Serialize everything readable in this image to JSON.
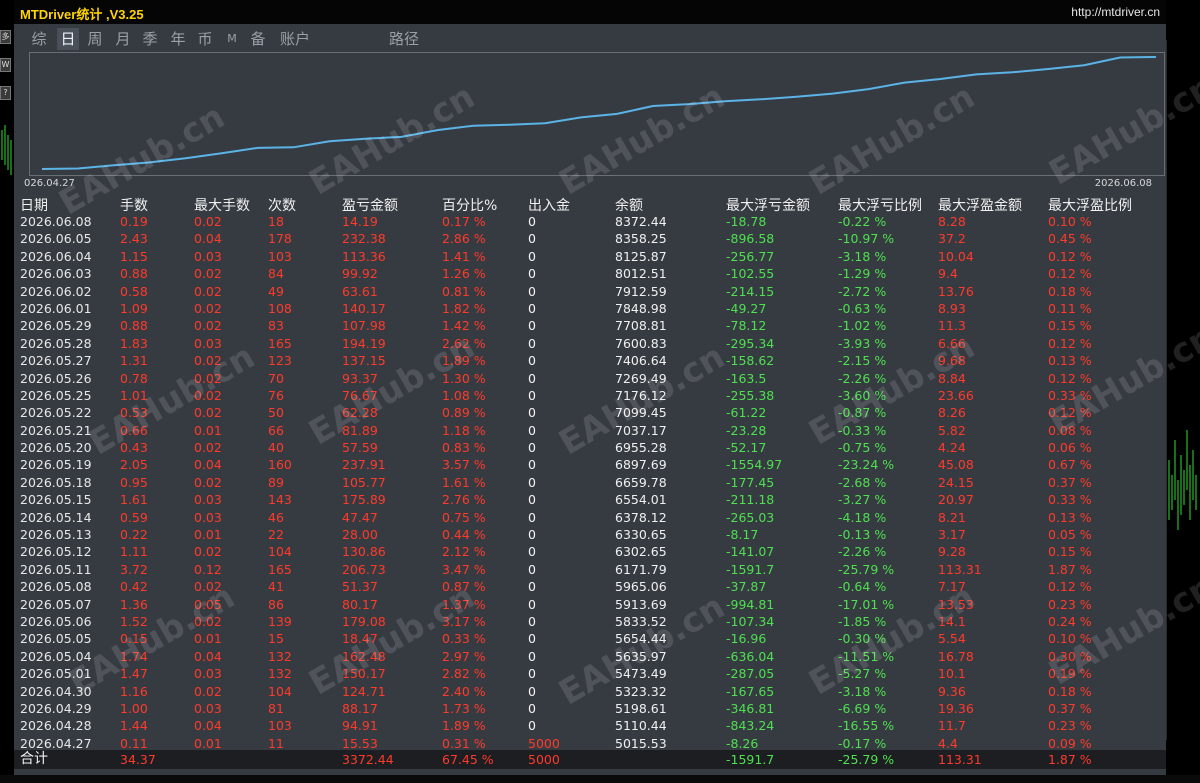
{
  "app": {
    "title": "MTDriver统计 ,V3.25",
    "url": "http://mtdriver.cn"
  },
  "tabs": [
    {
      "label": "综",
      "active": false
    },
    {
      "label": "日",
      "active": true
    },
    {
      "label": "周",
      "active": false
    },
    {
      "label": "月",
      "active": false
    },
    {
      "label": "季",
      "active": false
    },
    {
      "label": "年",
      "active": false
    },
    {
      "label": "币",
      "active": false
    },
    {
      "label": "M",
      "active": false
    },
    {
      "label": "备",
      "active": false
    },
    {
      "label": "账户",
      "active": false
    },
    {
      "label": "路径",
      "active": false
    }
  ],
  "side_buttons": [
    "多",
    "W",
    "?"
  ],
  "watermark": "EAHub.cn",
  "chart": {
    "start_label": "026.04.27",
    "end_label": "2026.06.08",
    "line_color": "#5bb3e6"
  },
  "table": {
    "headers": [
      "日期",
      "手数",
      "最大手数",
      "次数",
      "盈亏金额",
      "百分比%",
      "出入金",
      "余额",
      "最大浮亏金额",
      "最大浮亏比例",
      "最大浮盈金额",
      "最大浮盈比例"
    ],
    "rows": [
      [
        "2026.06.08",
        "0.19",
        "0.02",
        "18",
        "14.19",
        "0.17 %",
        "0",
        "8372.44",
        "-18.78",
        "-0.22 %",
        "8.28",
        "0.10 %"
      ],
      [
        "2026.06.05",
        "2.43",
        "0.04",
        "178",
        "232.38",
        "2.86 %",
        "0",
        "8358.25",
        "-896.58",
        "-10.97 %",
        "37.2",
        "0.45 %"
      ],
      [
        "2026.06.04",
        "1.15",
        "0.03",
        "103",
        "113.36",
        "1.41 %",
        "0",
        "8125.87",
        "-256.77",
        "-3.18 %",
        "10.04",
        "0.12 %"
      ],
      [
        "2026.06.03",
        "0.88",
        "0.02",
        "84",
        "99.92",
        "1.26 %",
        "0",
        "8012.51",
        "-102.55",
        "-1.29 %",
        "9.4",
        "0.12 %"
      ],
      [
        "2026.06.02",
        "0.58",
        "0.02",
        "49",
        "63.61",
        "0.81 %",
        "0",
        "7912.59",
        "-214.15",
        "-2.72 %",
        "13.76",
        "0.18 %"
      ],
      [
        "2026.06.01",
        "1.09",
        "0.02",
        "108",
        "140.17",
        "1.82 %",
        "0",
        "7848.98",
        "-49.27",
        "-0.63 %",
        "8.93",
        "0.11 %"
      ],
      [
        "2026.05.29",
        "0.88",
        "0.02",
        "83",
        "107.98",
        "1.42 %",
        "0",
        "7708.81",
        "-78.12",
        "-1.02 %",
        "11.3",
        "0.15 %"
      ],
      [
        "2026.05.28",
        "1.83",
        "0.03",
        "165",
        "194.19",
        "2.62 %",
        "0",
        "7600.83",
        "-295.34",
        "-3.93 %",
        "6.66",
        "0.12 %"
      ],
      [
        "2026.05.27",
        "1.31",
        "0.02",
        "123",
        "137.15",
        "1.89 %",
        "0",
        "7406.64",
        "-158.62",
        "-2.15 %",
        "9.68",
        "0.13 %"
      ],
      [
        "2026.05.26",
        "0.78",
        "0.02",
        "70",
        "93.37",
        "1.30 %",
        "0",
        "7269.49",
        "-163.5",
        "-2.26 %",
        "8.84",
        "0.12 %"
      ],
      [
        "2026.05.25",
        "1.01",
        "0.02",
        "76",
        "76.67",
        "1.08 %",
        "0",
        "7176.12",
        "-255.38",
        "-3.60 %",
        "23.66",
        "0.33 %"
      ],
      [
        "2026.05.22",
        "0.53",
        "0.02",
        "50",
        "62.28",
        "0.89 %",
        "0",
        "7099.45",
        "-61.22",
        "-0.87 %",
        "8.26",
        "0.12 %"
      ],
      [
        "2026.05.21",
        "0.66",
        "0.01",
        "66",
        "81.89",
        "1.18 %",
        "0",
        "7037.17",
        "-23.28",
        "-0.33 %",
        "5.82",
        "0.08 %"
      ],
      [
        "2026.05.20",
        "0.43",
        "0.02",
        "40",
        "57.59",
        "0.83 %",
        "0",
        "6955.28",
        "-52.17",
        "-0.75 %",
        "4.24",
        "0.06 %"
      ],
      [
        "2026.05.19",
        "2.05",
        "0.04",
        "160",
        "237.91",
        "3.57 %",
        "0",
        "6897.69",
        "-1554.97",
        "-23.24 %",
        "45.08",
        "0.67 %"
      ],
      [
        "2026.05.18",
        "0.95",
        "0.02",
        "89",
        "105.77",
        "1.61 %",
        "0",
        "6659.78",
        "-177.45",
        "-2.68 %",
        "24.15",
        "0.37 %"
      ],
      [
        "2026.05.15",
        "1.61",
        "0.03",
        "143",
        "175.89",
        "2.76 %",
        "0",
        "6554.01",
        "-211.18",
        "-3.27 %",
        "20.97",
        "0.33 %"
      ],
      [
        "2026.05.14",
        "0.59",
        "0.03",
        "46",
        "47.47",
        "0.75 %",
        "0",
        "6378.12",
        "-265.03",
        "-4.18 %",
        "8.21",
        "0.13 %"
      ],
      [
        "2026.05.13",
        "0.22",
        "0.01",
        "22",
        "28.00",
        "0.44 %",
        "0",
        "6330.65",
        "-8.17",
        "-0.13 %",
        "3.17",
        "0.05 %"
      ],
      [
        "2026.05.12",
        "1.11",
        "0.02",
        "104",
        "130.86",
        "2.12 %",
        "0",
        "6302.65",
        "-141.07",
        "-2.26 %",
        "9.28",
        "0.15 %"
      ],
      [
        "2026.05.11",
        "3.72",
        "0.12",
        "165",
        "206.73",
        "3.47 %",
        "0",
        "6171.79",
        "-1591.7",
        "-25.79 %",
        "113.31",
        "1.87 %"
      ],
      [
        "2026.05.08",
        "0.42",
        "0.02",
        "41",
        "51.37",
        "0.87 %",
        "0",
        "5965.06",
        "-37.87",
        "-0.64 %",
        "7.17",
        "0.12 %"
      ],
      [
        "2026.05.07",
        "1.36",
        "0.05",
        "86",
        "80.17",
        "1.37 %",
        "0",
        "5913.69",
        "-994.81",
        "-17.01 %",
        "13.53",
        "0.23 %"
      ],
      [
        "2026.05.06",
        "1.52",
        "0.02",
        "139",
        "179.08",
        "3.17 %",
        "0",
        "5833.52",
        "-107.34",
        "-1.85 %",
        "14.1",
        "0.24 %"
      ],
      [
        "2026.05.05",
        "0.15",
        "0.01",
        "15",
        "18.47",
        "0.33 %",
        "0",
        "5654.44",
        "-16.96",
        "-0.30 %",
        "5.54",
        "0.10 %"
      ],
      [
        "2026.05.04",
        "1.74",
        "0.04",
        "132",
        "162.48",
        "2.97 %",
        "0",
        "5635.97",
        "-636.04",
        "-11.51 %",
        "16.78",
        "0.30 %"
      ],
      [
        "2026.05.01",
        "1.47",
        "0.03",
        "132",
        "150.17",
        "2.82 %",
        "0",
        "5473.49",
        "-287.05",
        "-5.27 %",
        "10.1",
        "0.19 %"
      ],
      [
        "2026.04.30",
        "1.16",
        "0.02",
        "104",
        "124.71",
        "2.40 %",
        "0",
        "5323.32",
        "-167.65",
        "-3.18 %",
        "9.36",
        "0.18 %"
      ],
      [
        "2026.04.29",
        "1.00",
        "0.03",
        "81",
        "88.17",
        "1.73 %",
        "0",
        "5198.61",
        "-346.81",
        "-6.69 %",
        "19.36",
        "0.37 %"
      ],
      [
        "2026.04.28",
        "1.44",
        "0.04",
        "103",
        "94.91",
        "1.89 %",
        "0",
        "5110.44",
        "-843.24",
        "-16.55 %",
        "11.7",
        "0.23 %"
      ],
      [
        "2026.04.27",
        "0.11",
        "0.01",
        "11",
        "15.53",
        "0.31 %",
        "5000",
        "5015.53",
        "-8.26",
        "-0.17 %",
        "4.4",
        "0.09 %"
      ]
    ],
    "total": {
      "label": "合计",
      "lots": "34.37",
      "pl": "3372.44",
      "pct": "67.45 %",
      "deposit": "5000",
      "max_float_loss": "-1591.7",
      "max_float_loss_pct": "-25.79 %",
      "max_float_profit": "113.31",
      "max_float_profit_pct": "1.87 %"
    }
  }
}
